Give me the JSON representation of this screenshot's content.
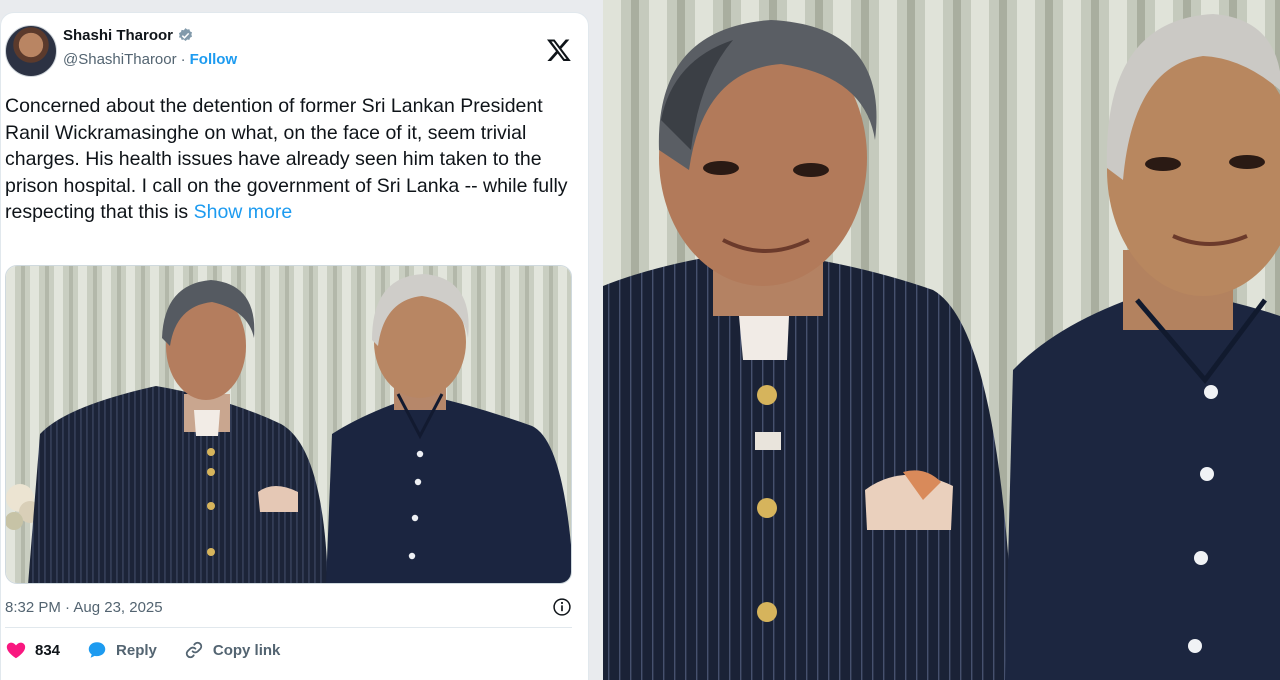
{
  "tweet": {
    "author_name": "Shashi Tharoor",
    "handle": "@ShashiTharoor",
    "separator": "·",
    "follow_label": "Follow",
    "body": "Concerned about the detention of former Sri Lankan President Ranil Wickramasinghe on what, on the face of it, seem trivial charges. His health issues have already seen him taken to the prison hospital. I call on the government of Sri Lanka -- while fully respecting that this is ",
    "show_more_label": "Show more",
    "timestamp": "8:32 PM · Aug 23, 2025",
    "likes": "834",
    "reply_label": "Reply",
    "copy_link_label": "Copy link"
  },
  "icons": {
    "verified": "verified-badge-icon",
    "platform": "x-logo-icon",
    "info": "info-icon",
    "like": "heart-icon",
    "reply": "speech-bubble-icon",
    "copy_link": "link-icon"
  },
  "colors": {
    "link_blue": "#1d9bf0",
    "like_pink": "#f91880",
    "text_primary": "#0f1419",
    "text_secondary": "#536471"
  }
}
